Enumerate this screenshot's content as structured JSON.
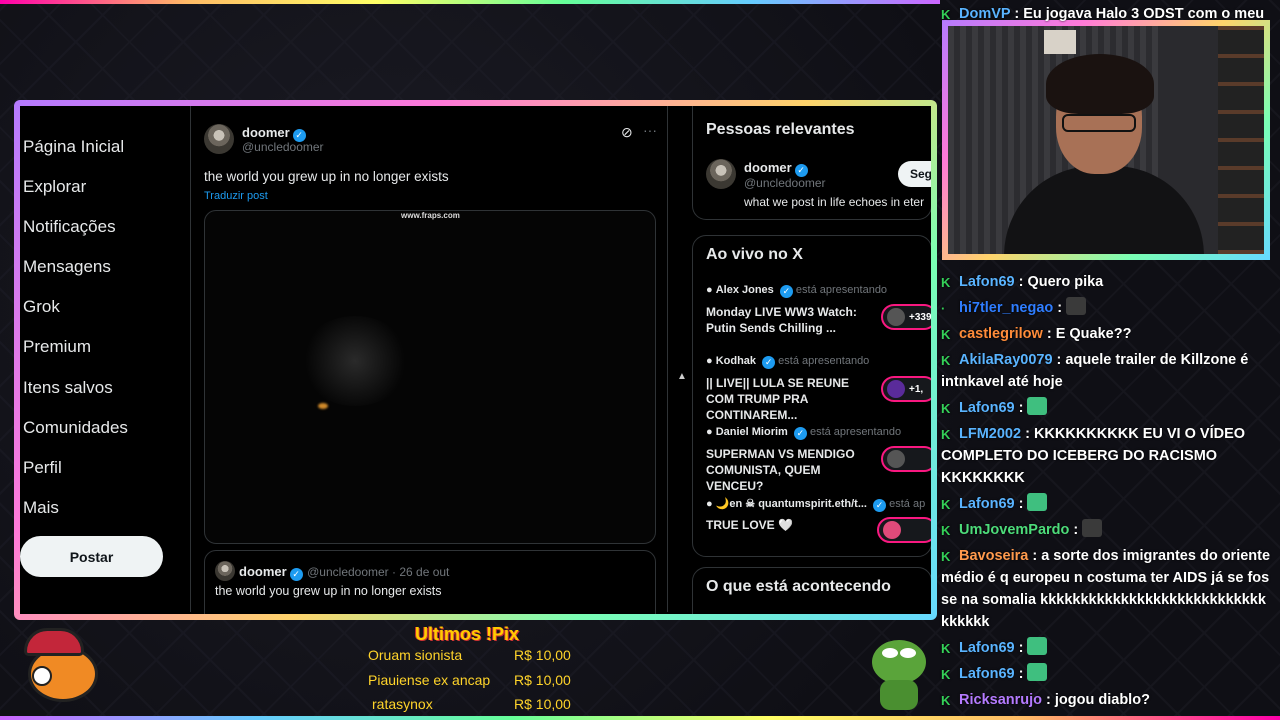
{
  "nav": {
    "items": [
      "Página Inicial",
      "Explorar",
      "Notificações",
      "Mensagens",
      "Grok",
      "Premium",
      "Itens salvos",
      "Comunidades",
      "Perfil",
      "Mais"
    ],
    "post_button": "Postar"
  },
  "tweet": {
    "name": "doomer",
    "handle": "@uncledoomer",
    "text": "the world you grew up in no longer exists",
    "translate": "Traduzir post",
    "video_watermark": "www.fraps.com",
    "more": "···"
  },
  "quote": {
    "name": "doomer",
    "handle": "@uncledoomer · 26 de out",
    "text": "the world you grew up in no longer exists"
  },
  "right": {
    "relevant_title": "Pessoas relevantes",
    "relevant_name": "doomer",
    "relevant_handle": "@uncledoomer",
    "relevant_bio": "what we post in life echoes in eter",
    "follow_label": "Seg",
    "live_title": "Ao vivo no X",
    "live": [
      {
        "host": "Alex Jones",
        "status": "está apresentando",
        "title": "Monday LIVE WW3 Watch: Putin Sends Chilling ...",
        "count": "+339"
      },
      {
        "host": "Kodhak",
        "status": "está apresentando",
        "title": "|| LIVE|| LULA SE REUNE COM TRUMP PRA CONTINAREM...",
        "count": "+1,"
      },
      {
        "host": "Daniel Miorim",
        "status": "está apresentando",
        "title": "SUPERMAN VS MENDIGO COMUNISTA, QUEM VENCEU?",
        "count": ""
      },
      {
        "host": "🌙en ☠ quantumspirit.eth/t...",
        "status": "está ap",
        "title": "TRUE LOVE 🤍",
        "count": ""
      }
    ],
    "happening_title": "O que está acontecendo"
  },
  "chat": [
    {
      "user": "DomVP",
      "color": "#5ab4ff",
      "text": "Eu jogava Halo 3 ODST com o meu"
    },
    {
      "user": "Lafon69",
      "color": "#5ab4ff",
      "text": "Quero pika"
    },
    {
      "user": "hi7tler_negao",
      "color": "#2f7dff",
      "text": "",
      "emote": "#3a3a3a"
    },
    {
      "user": "castlegrilow",
      "color": "#ff8c3a",
      "text": "E Quake??"
    },
    {
      "user": "AkilaRay0079",
      "color": "#5ab4ff",
      "text": "aquele trailer de Killzone é intnkavel até hoje"
    },
    {
      "user": "Lafon69",
      "color": "#5ab4ff",
      "text": "",
      "emote": "#3fbf7f"
    },
    {
      "user": "LFM2002",
      "color": "#5ab4ff",
      "text": "KKKKKKKKKK EU VI O VÍDEO COMPLETO DO ICEBERG DO RACISMO KKKKKKKK"
    },
    {
      "user": "Lafon69",
      "color": "#5ab4ff",
      "text": "",
      "emote": "#3fbf7f"
    },
    {
      "user": "UmJovemPardo",
      "color": "#4ddb7a",
      "text": "",
      "emote": "#3a3a3a"
    },
    {
      "user": "Bavoseira",
      "color": "#ff9a4d",
      "text": "a sorte dos imigrantes do oriente médio é q europeu n costuma ter AIDS já se fosse na somalia kkkkkkkkkkkkkkkkkkkkkkkkkkkkkkkkkk"
    },
    {
      "user": "Lafon69",
      "color": "#5ab4ff",
      "text": "",
      "emote": "#3fbf7f"
    },
    {
      "user": "Lafon69",
      "color": "#5ab4ff",
      "text": "",
      "emote": "#3fbf7f"
    },
    {
      "user": "Ricksanrujo",
      "color": "#b57bff",
      "text": "jogou diablo?"
    }
  ],
  "pix": {
    "title": "Ultimos !Pix",
    "rows": [
      {
        "name": "Oruam sionista",
        "amount": "R$ 10,00"
      },
      {
        "name": "Piauiense ex ancap",
        "amount": "R$ 10,00"
      },
      {
        "name": "ratasynox",
        "amount": "R$ 10,00"
      }
    ]
  }
}
